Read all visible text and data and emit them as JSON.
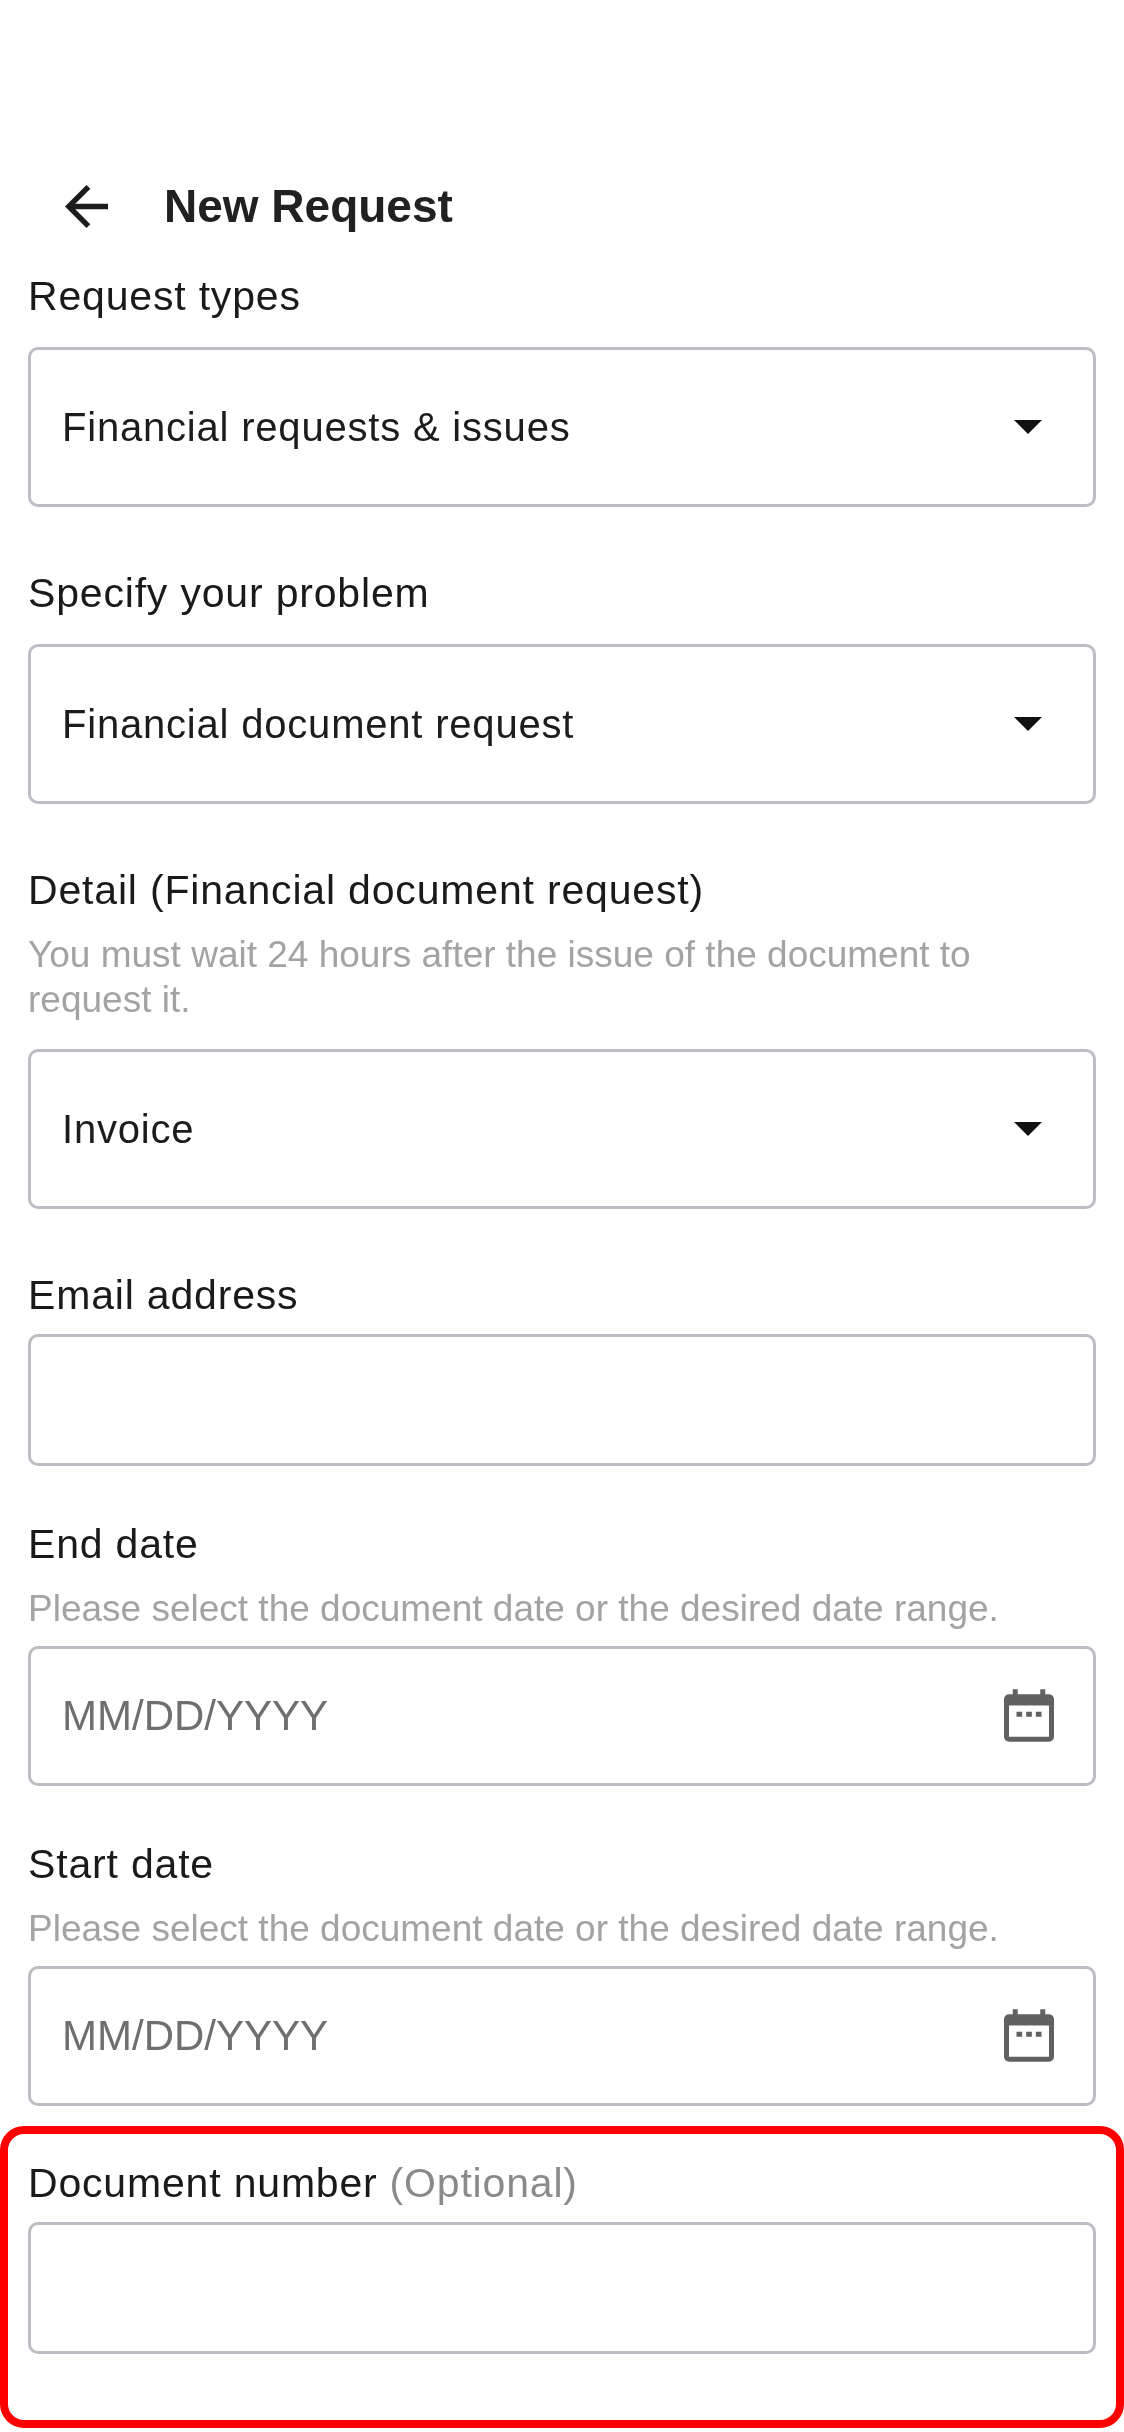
{
  "header": {
    "title": "New Request"
  },
  "fields": [
    {
      "kind": "dropdown",
      "label": "Request types",
      "value": "Financial requests & issues",
      "highlighted": false
    },
    {
      "kind": "dropdown",
      "label": "Specify your problem",
      "value": "Financial document request",
      "highlighted": false
    },
    {
      "kind": "dropdown",
      "label": "Detail (Financial document request)",
      "hint": "You must wait 24 hours after the issue of the document to request it.",
      "value": "Invoice",
      "highlighted": false
    },
    {
      "kind": "text",
      "label": "Email address",
      "highlighted": false
    },
    {
      "kind": "date",
      "label": "End date",
      "hint": "Please select the document date or the desired date range.",
      "placeholder": "MM/DD/YYYY",
      "highlighted": false
    },
    {
      "kind": "date",
      "label": "Start date",
      "hint": "Please select the document date or the desired date range.",
      "placeholder": "MM/DD/YYYY",
      "highlighted": false
    },
    {
      "kind": "text",
      "label": "Document number",
      "optional_note": "(Optional)",
      "highlighted": true
    }
  ]
}
